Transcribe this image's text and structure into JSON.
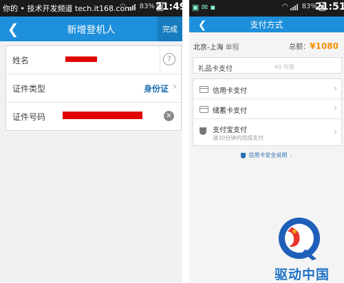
{
  "left": {
    "status": {
      "text": "你的 • 技术开发频道 tech.it168.com",
      "battery": "83%",
      "time": "21:49"
    },
    "appbar": {
      "back_icon": "back-arrow-icon",
      "title": "新增登机人",
      "done_label": "完成"
    },
    "form": {
      "name_label": "姓名",
      "id_type_label": "证件类型",
      "id_type_value": "身份证",
      "id_number_label": "证件号码"
    }
  },
  "right": {
    "status": {
      "battery": "83%",
      "time": "21:51"
    },
    "appbar": {
      "back_icon": "back-arrow-icon",
      "title": "支付方式"
    },
    "route": "北京-上海",
    "trip_type": "单程",
    "total_label": "总额：",
    "total_amount": "¥1080",
    "gift_card": {
      "label": "礼品卡支付",
      "value": "¥0 可用"
    },
    "payment_methods": [
      {
        "label": "信用卡支付",
        "icon": "card-icon"
      },
      {
        "label": "储蓄卡支付",
        "icon": "card-icon"
      },
      {
        "label": "支付宝支付",
        "sublabel": "请30分钟内完成支付",
        "icon": "alipay-shield-icon"
      }
    ],
    "safety_note": "信用卡安全说明"
  },
  "watermark": {
    "text": "驱动中国"
  },
  "colors": {
    "accent": "#1d8fdb",
    "status_bar": "#1b1b1b",
    "redaction": "#e00000",
    "price": "#f29100",
    "link_blue": "#1d6fb0"
  }
}
